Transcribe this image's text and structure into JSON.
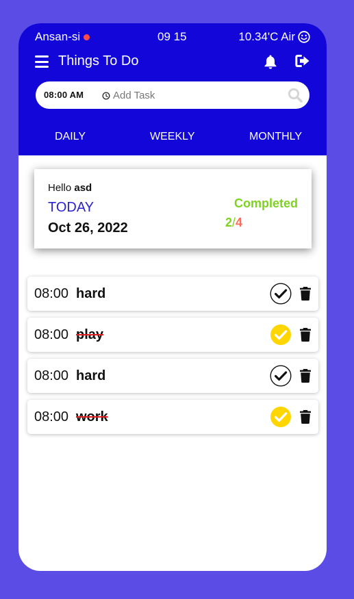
{
  "status_bar": {
    "location": "Ansan-si",
    "time": "09 15",
    "weather": "10.34'C Air"
  },
  "header": {
    "title": "Things To Do"
  },
  "task_entry": {
    "time": "08:00 AM",
    "placeholder": "Add Task"
  },
  "tabs": [
    {
      "label": "DAILY"
    },
    {
      "label": "WEEKLY"
    },
    {
      "label": "MONTHLY"
    }
  ],
  "summary": {
    "greeting": "Hello",
    "user": "asd",
    "today_label": "TODAY",
    "date": "Oct 26, 2022",
    "completed_label": "Completed",
    "completed_count": "2",
    "total_count": "4"
  },
  "tasks": [
    {
      "time": "08:00",
      "name": "hard",
      "done": false
    },
    {
      "time": "08:00",
      "name": "play",
      "done": true
    },
    {
      "time": "08:00",
      "name": "hard",
      "done": false
    },
    {
      "time": "08:00",
      "name": "work",
      "done": true
    }
  ],
  "colors": {
    "header": "#1206d9",
    "background": "#5b4ce6",
    "done": "#ffd600",
    "completed": "#7ed321",
    "total": "#ff6b5a",
    "today": "#2a22d2"
  }
}
